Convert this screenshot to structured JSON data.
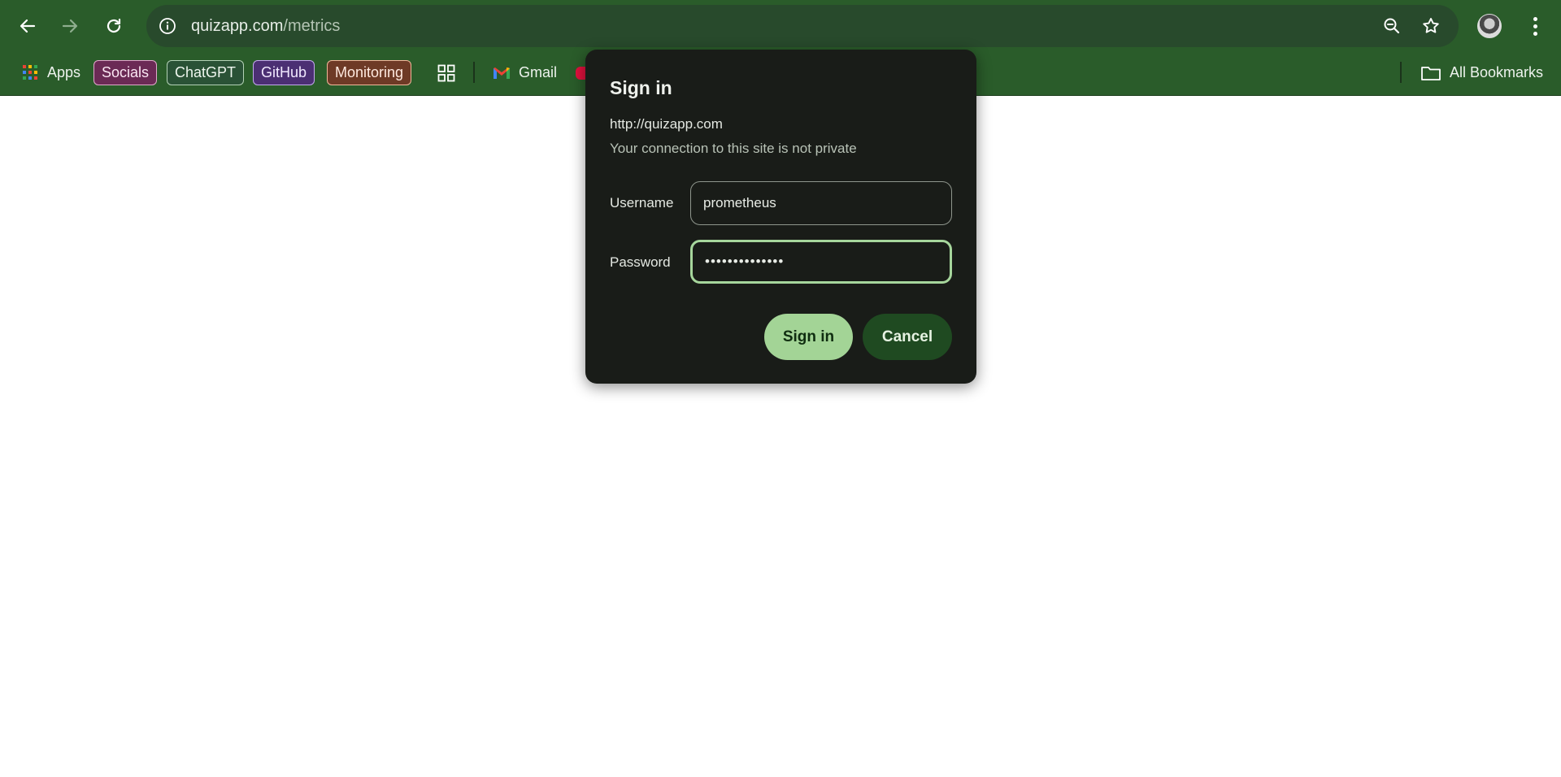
{
  "browser": {
    "url_host": "quizapp.com",
    "url_path": "/metrics"
  },
  "bookmarks": {
    "apps_label": "Apps",
    "items": [
      {
        "label": "Socials"
      },
      {
        "label": "ChatGPT"
      },
      {
        "label": "GitHub"
      },
      {
        "label": "Monitoring"
      }
    ],
    "gmail_label": "Gmail",
    "all_bookmarks_label": "All Bookmarks"
  },
  "dialog": {
    "title": "Sign in",
    "origin": "http://quizapp.com",
    "warning": "Your connection to this site is not private",
    "username_label": "Username",
    "username_value": "prometheus",
    "password_label": "Password",
    "password_value": "••••••••••••••",
    "signin_label": "Sign in",
    "cancel_label": "Cancel"
  },
  "colors": {
    "chrome_green": "#2a5c2a",
    "dialog_bg": "#191c18",
    "accent": "#a3d496"
  }
}
